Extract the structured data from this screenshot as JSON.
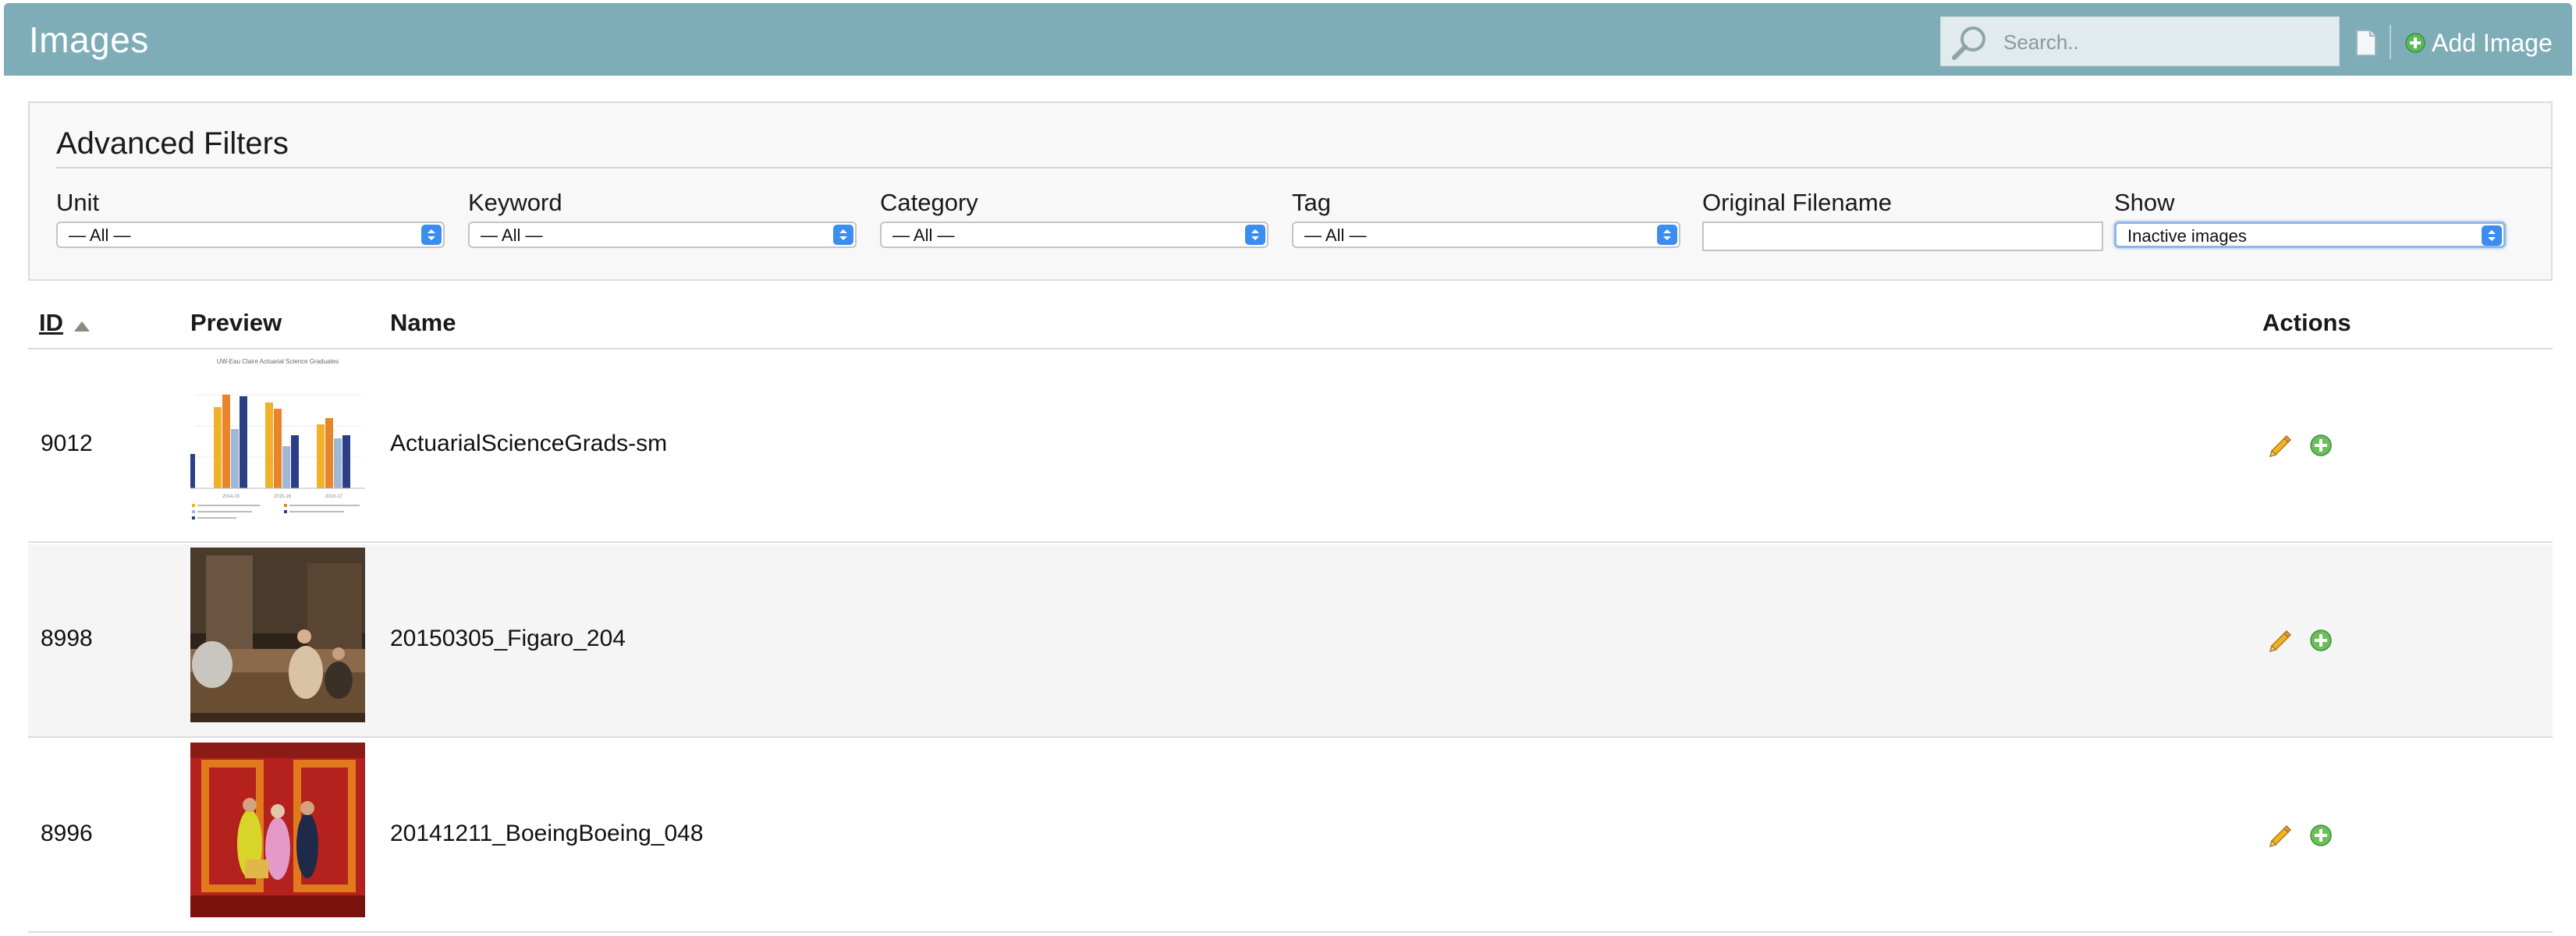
{
  "header": {
    "title": "Images",
    "search_placeholder": "Search..",
    "add_label": "Add Image",
    "color": "#7eadb8"
  },
  "filters": {
    "title": "Advanced Filters",
    "unit": {
      "label": "Unit",
      "value": "— All —"
    },
    "keyword": {
      "label": "Keyword",
      "value": "— All —"
    },
    "category": {
      "label": "Category",
      "value": "— All —"
    },
    "tag": {
      "label": "Tag",
      "value": "— All —"
    },
    "original_filename": {
      "label": "Original Filename",
      "value": ""
    },
    "show": {
      "label": "Show",
      "value": "Inactive images"
    }
  },
  "table": {
    "columns": {
      "id": "ID",
      "preview": "Preview",
      "name": "Name",
      "actions": "Actions"
    },
    "rows": [
      {
        "id": "9012",
        "name": "ActuarialScienceGrads-sm"
      },
      {
        "id": "8998",
        "name": "20150305_Figaro_204"
      },
      {
        "id": "8996",
        "name": "20141211_BoeingBoeing_048"
      }
    ]
  },
  "thumb_chart": {
    "title": "UW-Eau Claire Actuarial Science Graduates",
    "categories": [
      "2014-15",
      "2015-16",
      "2016-17"
    ]
  },
  "icons": {
    "search": "magnifier-icon",
    "document": "document-icon",
    "add": "plus-circle-icon",
    "edit": "pencil-icon",
    "sort": "sort-ascending-icon"
  }
}
